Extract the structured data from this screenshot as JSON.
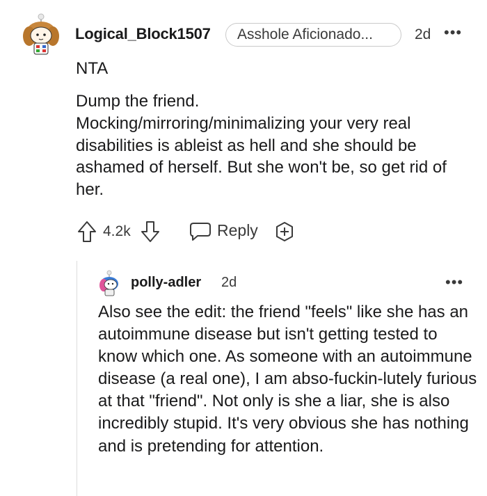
{
  "comment": {
    "username": "Logical_Block1507",
    "flair": "Asshole Aficionado...",
    "timestamp": "2d",
    "more_label": "•••",
    "verdict": "NTA",
    "body": [
      "Dump the friend.",
      "Mocking/mirroring/minimalizing your very real disabilities is ableist as hell and she should be ashamed of herself. But she won't be, so get rid of her."
    ],
    "score": "4.2k",
    "reply_label": "Reply"
  },
  "reply": {
    "username": "polly-adler",
    "timestamp": "2d",
    "more_label": "•••",
    "body": "Also see the edit: the friend \"feels\" like she has an autoimmune disease but isn't getting tested to know which one. As someone with an autoimmune disease (a real one), I am abso-fuckin-lutely furious at that \"friend\". Not only is she a liar, she is also incredibly stupid. It's very obvious she has nothing and is pretending for attention."
  },
  "icons": {
    "upvote": "upvote-arrow-icon",
    "downvote": "downvote-arrow-icon",
    "reply": "speech-bubble-icon",
    "award": "award-plus-icon",
    "more": "ellipsis-icon"
  },
  "colors": {
    "text": "#1a1a1b",
    "muted": "#3a3a3a",
    "border": "#c9c9c9",
    "thread_line": "#dcdcdc"
  }
}
